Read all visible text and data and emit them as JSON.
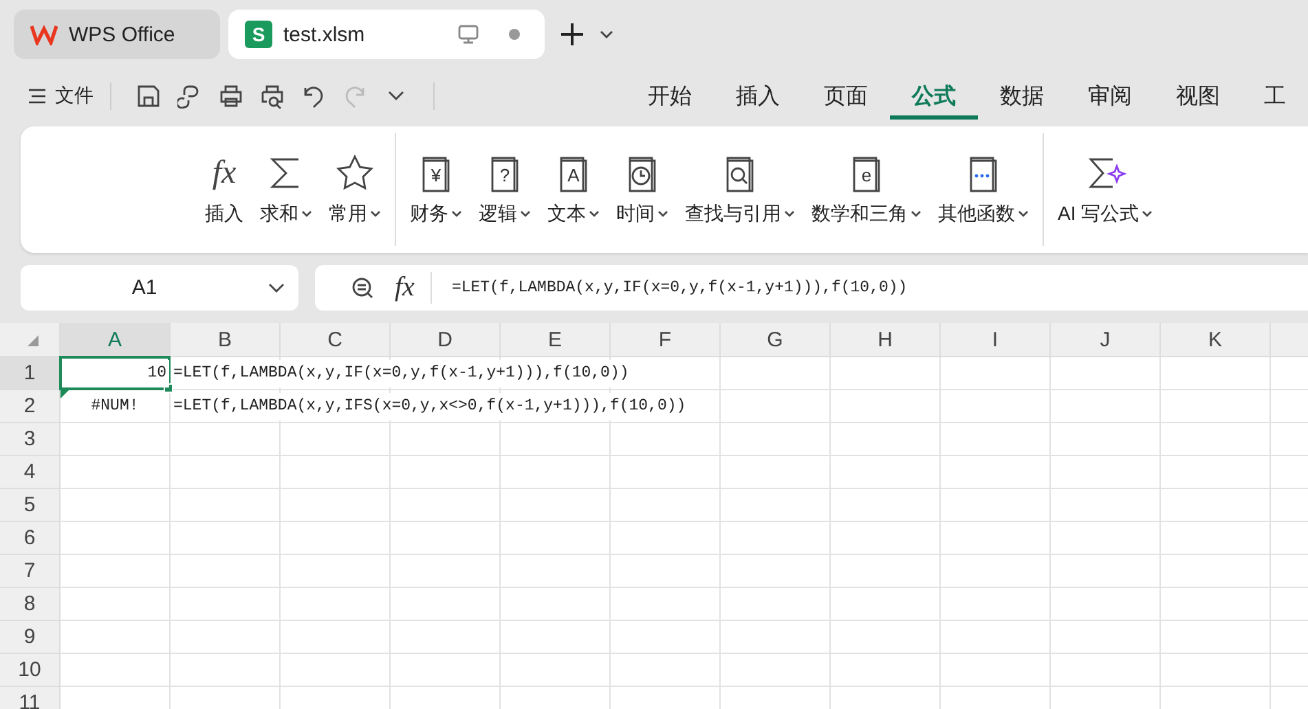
{
  "app_tabs": [
    {
      "label": "WPS Office",
      "kind": "home",
      "selected": false
    },
    {
      "label": "test.xlsm",
      "kind": "file",
      "badge": "S",
      "selected": true
    }
  ],
  "menu": {
    "label": "文件"
  },
  "ribbon_tabs": [
    {
      "label": "开始",
      "selected": false
    },
    {
      "label": "插入",
      "selected": false
    },
    {
      "label": "页面",
      "selected": false
    },
    {
      "label": "公式",
      "selected": true
    },
    {
      "label": "数据",
      "selected": false
    },
    {
      "label": "审阅",
      "selected": false
    },
    {
      "label": "视图",
      "selected": false
    },
    {
      "label": "工",
      "selected": false
    }
  ],
  "ribbon_groups": [
    [
      {
        "label": "插入",
        "kind": "fx",
        "glyph": "fx",
        "dropdown": false
      },
      {
        "label": "求和",
        "kind": "sum",
        "dropdown": true
      },
      {
        "label": "常用",
        "kind": "star",
        "dropdown": true
      }
    ],
    [
      {
        "label": "财务",
        "kind": "book",
        "glyph": "¥",
        "dropdown": true
      },
      {
        "label": "逻辑",
        "kind": "book",
        "glyph": "?",
        "dropdown": true
      },
      {
        "label": "文本",
        "kind": "book",
        "glyph": "A",
        "dropdown": true
      },
      {
        "label": "时间",
        "kind": "clock",
        "dropdown": true
      },
      {
        "label": "查找与引用",
        "kind": "search",
        "dropdown": true
      },
      {
        "label": "数学和三角",
        "kind": "book",
        "glyph": "e",
        "dropdown": true
      },
      {
        "label": "其他函数",
        "kind": "dots",
        "dropdown": true
      }
    ],
    [
      {
        "label": "AI 写公式",
        "kind": "ai",
        "dropdown": true
      }
    ]
  ],
  "name_box": "A1",
  "formula_bar": {
    "fx": "fx",
    "value": "=LET(f,LAMBDA(x,y,IF(x=0,y,f(x-1,y+1))),f(10,0))"
  },
  "columns": [
    {
      "label": "A",
      "selected": true
    },
    {
      "label": "B",
      "selected": false
    },
    {
      "label": "C",
      "selected": false
    },
    {
      "label": "D",
      "selected": false
    },
    {
      "label": "E",
      "selected": false
    },
    {
      "label": "F",
      "selected": false
    },
    {
      "label": "G",
      "selected": false
    },
    {
      "label": "H",
      "selected": false
    },
    {
      "label": "I",
      "selected": false
    },
    {
      "label": "J",
      "selected": false
    },
    {
      "label": "K",
      "selected": false
    }
  ],
  "rows": [
    {
      "header": "1",
      "selected": true,
      "cells": [
        {
          "text": "10",
          "kind": "number",
          "selected": true
        },
        {
          "text": "=LET(f,LAMBDA(x,y,IF(x=0,y,f(x-1,y+1))),f(10,0))",
          "kind": "text",
          "selected": false
        }
      ]
    },
    {
      "header": "2",
      "selected": false,
      "cells": [
        {
          "text": "#NUM!",
          "kind": "error",
          "selected": false
        },
        {
          "text": "=LET(f,LAMBDA(x,y,IFS(x=0,y,x<>0,f(x-1,y+1))),f(10,0))",
          "kind": "text",
          "selected": false
        }
      ]
    },
    {
      "header": "3",
      "selected": false,
      "cells": []
    },
    {
      "header": "4",
      "selected": false,
      "cells": []
    },
    {
      "header": "5",
      "selected": false,
      "cells": []
    },
    {
      "header": "6",
      "selected": false,
      "cells": []
    },
    {
      "header": "7",
      "selected": false,
      "cells": []
    },
    {
      "header": "8",
      "selected": false,
      "cells": []
    },
    {
      "header": "9",
      "selected": false,
      "cells": []
    },
    {
      "header": "10",
      "selected": false,
      "cells": []
    },
    {
      "header": "11",
      "selected": false,
      "cells": []
    }
  ]
}
